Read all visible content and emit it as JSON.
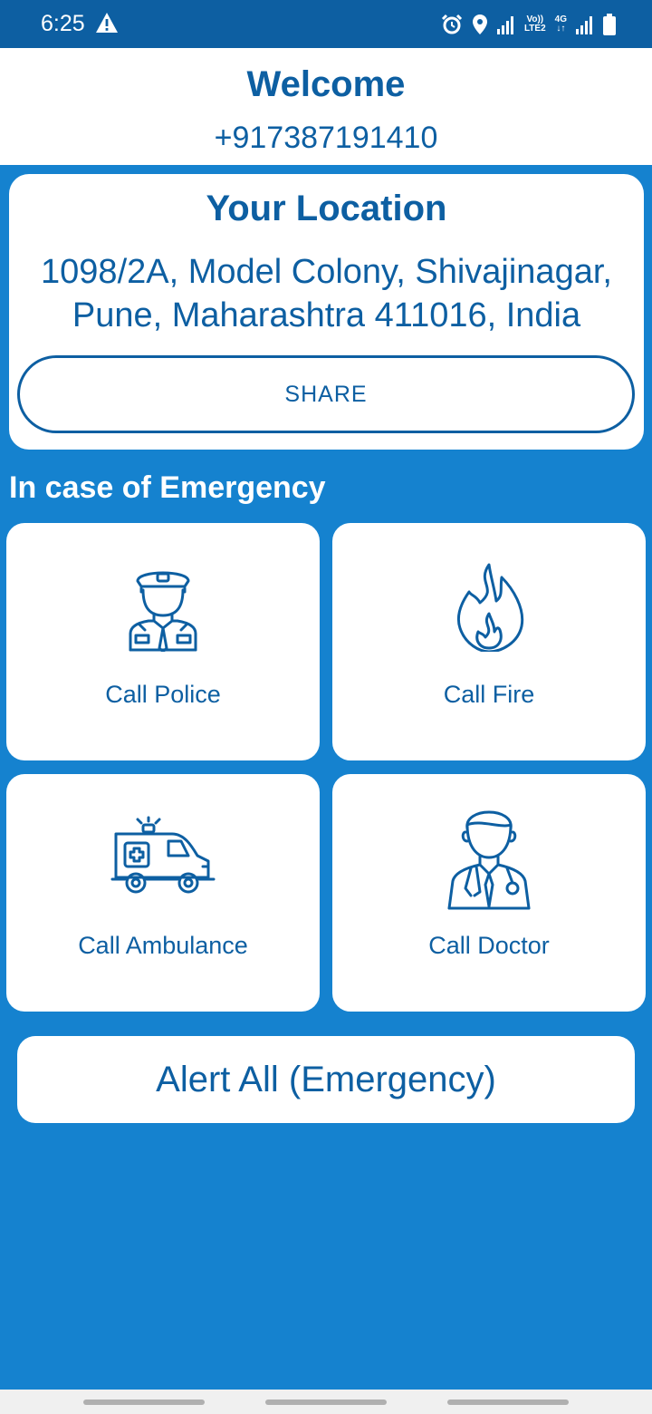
{
  "status_bar": {
    "time": "6:25",
    "volte": "Vo))",
    "lte": "LTE2",
    "net": "4G"
  },
  "header": {
    "title": "Welcome",
    "phone": "+917387191410"
  },
  "location": {
    "title": "Your Location",
    "address_line1": "1098/2A, Model Colony, Shivajinagar,",
    "address_line2": "Pune, Maharashtra 411016, India",
    "share_label": "SHARE"
  },
  "emergency": {
    "title": "In case of Emergency",
    "items": [
      {
        "label": "Call Police",
        "icon": "police-icon"
      },
      {
        "label": "Call Fire",
        "icon": "fire-icon"
      },
      {
        "label": "Call Ambulance",
        "icon": "ambulance-icon"
      },
      {
        "label": "Call Doctor",
        "icon": "doctor-icon"
      }
    ]
  },
  "alert_all_label": "Alert All (Emergency)",
  "colors": {
    "primary": "#0d5fa2",
    "background": "#1582cf",
    "card": "#ffffff"
  }
}
